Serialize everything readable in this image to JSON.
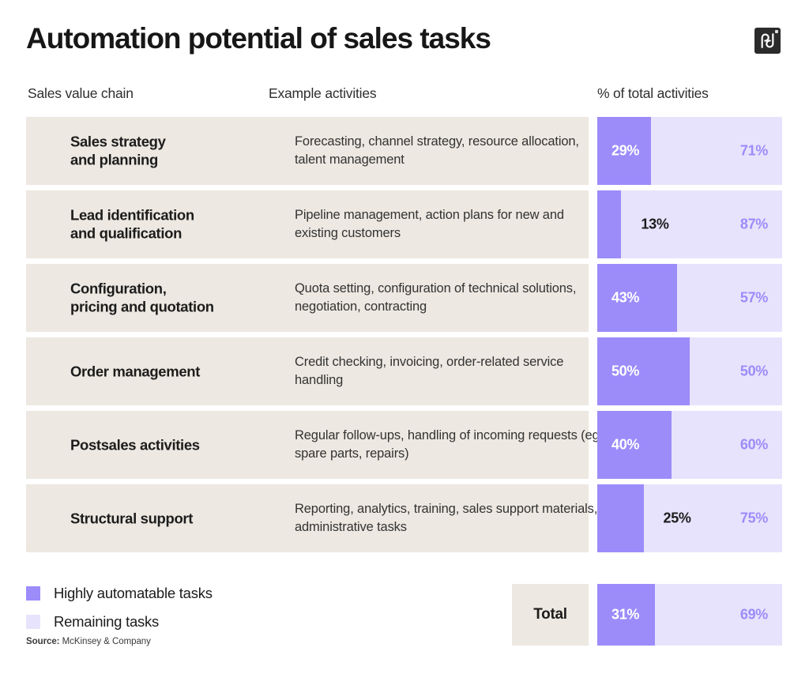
{
  "header": {
    "title": "Automation potential of sales tasks",
    "logo_name": "pd"
  },
  "columns": [
    "Sales value chain",
    "Example activities",
    "% of total activities"
  ],
  "legend": [
    {
      "label": "Highly automatable tasks",
      "color": "#9B8CFA"
    },
    {
      "label": "Remaining tasks",
      "color": "#E8E3FC"
    }
  ],
  "source": {
    "key": "Source:",
    "value": " McKinsey & Company"
  },
  "total": {
    "label": "Total",
    "automatable_label": "31%",
    "remaining_label": "69%",
    "automatable": 31,
    "remaining": 69
  },
  "chart_data": {
    "type": "bar",
    "title": "Automation potential of sales tasks",
    "subtitle": "",
    "xlabel": "% of total activities",
    "ylabel": "Sales value chain",
    "orientation": "horizontal",
    "stacked": true,
    "xlim": [
      0,
      100
    ],
    "grid": false,
    "legend_position": "bottom-left",
    "source": "McKinsey & Company",
    "categories": [
      "Sales strategy and planning",
      "Lead identification and qualification",
      "Configuration, pricing and quotation",
      "Order management",
      "Postsales activities",
      "Structural support"
    ],
    "series": [
      {
        "name": "Highly automatable tasks",
        "color": "#9B8CFA",
        "values": [
          29,
          13,
          43,
          50,
          40,
          25
        ]
      },
      {
        "name": "Remaining tasks",
        "color": "#E8E3FC",
        "values": [
          71,
          87,
          57,
          50,
          60,
          75
        ]
      }
    ],
    "total": {
      "Highly automatable tasks": 31,
      "Remaining tasks": 69
    }
  },
  "rows": [
    {
      "label": "Sales strategy\nand planning",
      "activity": "Forecasting, channel strategy, resource allocation, talent management",
      "automatable": 29,
      "automatable_label": "29%",
      "remaining": 71,
      "remaining_label": "71%",
      "label_placement": "inside"
    },
    {
      "label": "Lead identification\nand qualification",
      "activity": "Pipeline management, action plans for new and existing customers",
      "automatable": 13,
      "automatable_label": "13%",
      "remaining": 87,
      "remaining_label": "87%",
      "label_placement": "outside"
    },
    {
      "label": "Configuration,\npricing and quotation",
      "activity": "Quota setting, configuration of technical solutions, negotiation, contracting",
      "automatable": 43,
      "automatable_label": "43%",
      "remaining": 57,
      "remaining_label": "57%",
      "label_placement": "inside"
    },
    {
      "label": "Order management",
      "activity": "Credit checking, invoicing, order-related service handling",
      "automatable": 50,
      "automatable_label": "50%",
      "remaining": 50,
      "remaining_label": "50%",
      "label_placement": "inside"
    },
    {
      "label": "Postsales activities",
      "activity": "Regular follow-ups, handling of incoming requests (eg, spare parts, repairs)",
      "automatable": 40,
      "automatable_label": "40%",
      "remaining": 60,
      "remaining_label": "60%",
      "label_placement": "inside"
    },
    {
      "label": "Structural support",
      "activity": "Reporting, analytics, training, sales support materials, administrative tasks",
      "automatable": 25,
      "automatable_label": "25%",
      "remaining": 75,
      "remaining_label": "75%",
      "label_placement": "outside"
    }
  ]
}
